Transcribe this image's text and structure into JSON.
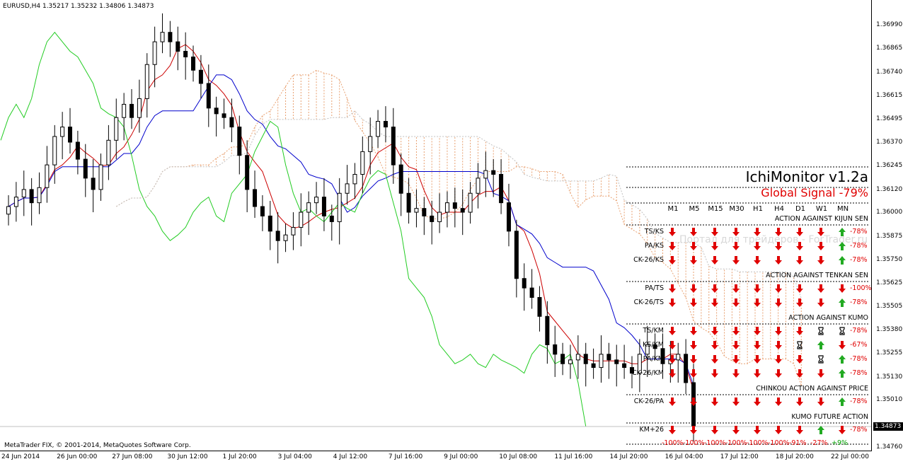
{
  "header": {
    "symbol_info": "EURUSD,H4  1.35217 1.35232 1.34806 1.34873"
  },
  "footer": {
    "copyright": "MetaTrader FIX, © 2001-2014, MetaQuotes Software Corp."
  },
  "watermark": "Портал для трейдеров - ForTrader.ru",
  "price_scale": {
    "labels": [
      "1.36990",
      "1.36865",
      "1.36740",
      "1.36615",
      "1.36495",
      "1.36370",
      "1.36245",
      "1.36120",
      "1.36000",
      "1.35875",
      "1.35750",
      "1.35625",
      "1.35505",
      "1.35380",
      "1.35255",
      "1.35130",
      "1.35010",
      "1.34760"
    ],
    "current": "1.34873"
  },
  "time_scale": [
    "24 Jun 2014",
    "26 Jun 00:00",
    "27 Jun 08:00",
    "30 Jun 12:00",
    "1 Jul 20:00",
    "3 Jul 04:00",
    "4 Jul 12:00",
    "7 Jul 16:00",
    "9 Jul 00:00",
    "10 Jul 08:00",
    "11 Jul 16:00",
    "14 Jul 20:00",
    "16 Jul 04:00",
    "17 Jul 12:00",
    "18 Jul 20:00",
    "22 Jul 00:00"
  ],
  "panel": {
    "title": "IchiMonitor v1.2a",
    "global_signal": "Global Signal -79%",
    "timeframes": [
      "M1",
      "M5",
      "M15",
      "M30",
      "H1",
      "H4",
      "D1",
      "W1",
      "MN"
    ],
    "colors": {
      "down": "#e00000",
      "up": "#22aa22",
      "neutral": "#000000"
    },
    "sections": [
      {
        "title": "ACTION AGAINST KIJUN SEN",
        "rows": [
          {
            "label": "TS/KS",
            "signals": [
              "down",
              "down",
              "down",
              "down",
              "down",
              "down",
              "down",
              "down",
              "up"
            ],
            "pct": "-78%"
          },
          {
            "label": "PA/KS",
            "signals": [
              "down",
              "down",
              "down",
              "down",
              "down",
              "down",
              "down",
              "down",
              "up"
            ],
            "pct": "-78%"
          },
          {
            "label": "CK-26/KS",
            "signals": [
              "down",
              "down",
              "down",
              "down",
              "down",
              "down",
              "down",
              "down",
              "up"
            ],
            "pct": "-78%"
          }
        ]
      },
      {
        "title": "ACTION AGAINST TENKAN SEN",
        "rows": [
          {
            "label": "PA/TS",
            "signals": [
              "down",
              "down",
              "down",
              "down",
              "down",
              "down",
              "down",
              "down",
              "down"
            ],
            "pct": "-100%"
          },
          {
            "label": "CK-26/TS",
            "signals": [
              "down",
              "down",
              "down",
              "down",
              "down",
              "down",
              "down",
              "down",
              "up"
            ],
            "pct": "-78%"
          }
        ]
      },
      {
        "title": "ACTION AGAINST KUMO",
        "rows": [
          {
            "label": "TS/KM",
            "signals": [
              "down",
              "down",
              "down",
              "down",
              "down",
              "down",
              "down",
              "neutral",
              "neutral"
            ],
            "pct": "-78%"
          },
          {
            "label": "KS/KM",
            "signals": [
              "down",
              "down",
              "down",
              "down",
              "down",
              "down",
              "neutral",
              "up",
              "down"
            ],
            "pct": "-67%"
          },
          {
            "label": "PA/KM",
            "signals": [
              "down",
              "down",
              "down",
              "down",
              "down",
              "down",
              "down",
              "neutral",
              "up"
            ],
            "pct": "-78%"
          },
          {
            "label": "CK-26/KM",
            "signals": [
              "down",
              "down",
              "down",
              "down",
              "down",
              "down",
              "down",
              "down",
              "up"
            ],
            "pct": "-78%"
          }
        ]
      },
      {
        "title": "CHINKOU ACTION AGAINST PRICE",
        "rows": [
          {
            "label": "CK-26/PA",
            "signals": [
              "down",
              "down",
              "down",
              "down",
              "down",
              "down",
              "down",
              "down",
              "up"
            ],
            "pct": "-78%"
          }
        ]
      },
      {
        "title": "KUMO FUTURE ACTION",
        "rows": [
          {
            "label": "KM+26",
            "signals": [
              "down",
              "down",
              "down",
              "down",
              "down",
              "down",
              "down",
              "up",
              "down"
            ],
            "pct": "-78%"
          }
        ]
      }
    ],
    "footer_pcts": [
      "-100%",
      "-100%",
      "-100%",
      "-100%",
      "-100%",
      "-100%",
      "-91%",
      "-27%",
      "+9%"
    ]
  },
  "chart_data": {
    "type": "candlestick",
    "symbol": "EURUSD",
    "timeframe": "H4",
    "ylim": [
      1.3468,
      1.371
    ],
    "last_price": 1.34873,
    "tenkan_color": "#cc0000",
    "kijun_color": "#0000cc",
    "chikou_color": "#22cc22",
    "cloud_color": "#e8a070",
    "closes": [
      1.3603,
      1.3608,
      1.3612,
      1.3605,
      1.3613,
      1.3625,
      1.364,
      1.3645,
      1.3637,
      1.3628,
      1.3618,
      1.3612,
      1.3625,
      1.3638,
      1.365,
      1.3657,
      1.365,
      1.366,
      1.3678,
      1.369,
      1.3695,
      1.369,
      1.3685,
      1.3682,
      1.3675,
      1.3668,
      1.3655,
      1.3652,
      1.365,
      1.3645,
      1.363,
      1.3612,
      1.3603,
      1.3598,
      1.359,
      1.3585,
      1.3588,
      1.3592,
      1.36,
      1.3605,
      1.3608,
      1.3598,
      1.3595,
      1.361,
      1.3615,
      1.362,
      1.3632,
      1.364,
      1.3648,
      1.3645,
      1.3625,
      1.361,
      1.36,
      1.3602,
      1.3598,
      1.3595,
      1.36,
      1.3605,
      1.3602,
      1.36,
      1.361,
      1.3618,
      1.3622,
      1.362,
      1.3605,
      1.359,
      1.3565,
      1.356,
      1.3555,
      1.3545,
      1.353,
      1.3525,
      1.352,
      1.3522,
      1.3525,
      1.352,
      1.3518,
      1.3525,
      1.3522,
      1.352,
      1.3518,
      1.3515,
      1.3525,
      1.353,
      1.3528,
      1.352,
      1.3522,
      1.3525,
      1.351,
      1.3487
    ]
  }
}
